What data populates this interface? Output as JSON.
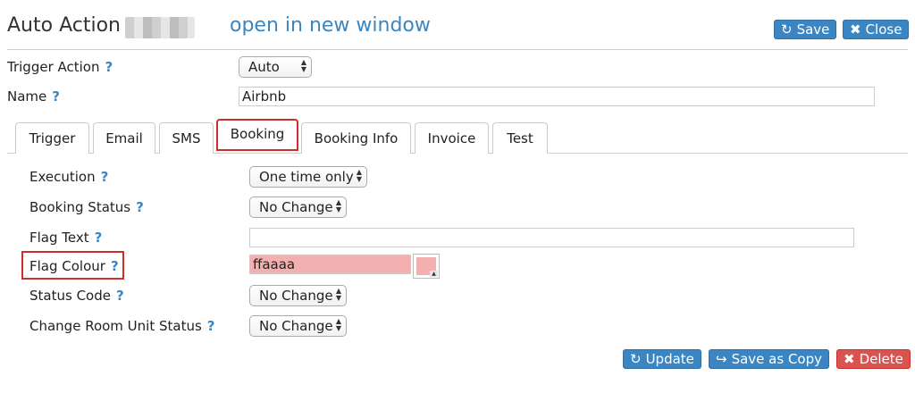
{
  "header": {
    "title": "Auto Action",
    "open_new_window": "open in new window",
    "save_label": "Save",
    "close_label": "Close"
  },
  "form": {
    "trigger_action_label": "Trigger Action",
    "trigger_action_value": "Auto",
    "name_label": "Name",
    "name_value": "Airbnb"
  },
  "tabs": [
    {
      "label": "Trigger"
    },
    {
      "label": "Email"
    },
    {
      "label": "SMS"
    },
    {
      "label": "Booking",
      "active": true
    },
    {
      "label": "Booking Info"
    },
    {
      "label": "Invoice"
    },
    {
      "label": "Test"
    }
  ],
  "booking": {
    "execution_label": "Execution",
    "execution_value": "One time only",
    "booking_status_label": "Booking Status",
    "booking_status_value": "No Change",
    "flag_text_label": "Flag Text",
    "flag_text_value": "",
    "flag_colour_label": "Flag Colour",
    "flag_colour_value": "ffaaaa",
    "status_code_label": "Status Code",
    "status_code_value": "No Change",
    "room_unit_status_label": "Change Room Unit Status",
    "room_unit_status_value": "No Change"
  },
  "help_icon": "?",
  "footer": {
    "update_label": "Update",
    "save_copy_label": "Save as Copy",
    "delete_label": "Delete"
  },
  "colors": {
    "accent": "#3b86c2",
    "danger": "#d9534f",
    "flag_colour": "#ffaaaa"
  }
}
